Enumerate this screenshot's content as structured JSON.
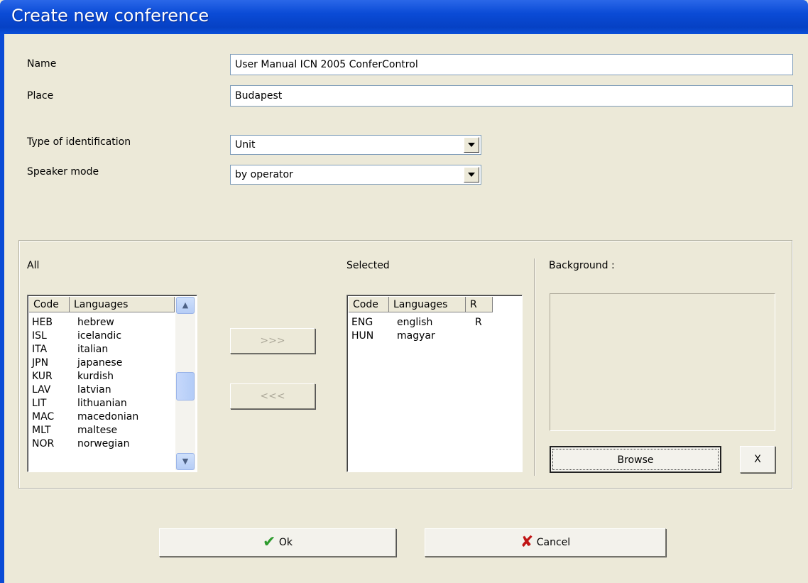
{
  "window": {
    "title": "Create new conference"
  },
  "form": {
    "name_label": "Name",
    "name_value": "User Manual ICN 2005 ConferControl",
    "place_label": "Place",
    "place_value": "Budapest",
    "identification_label": "Type of identification",
    "identification_value": "Unit",
    "speaker_mode_label": "Speaker mode",
    "speaker_mode_value": "by operator"
  },
  "all_list": {
    "title": "All",
    "col_code": "Code",
    "col_languages": "Languages",
    "rows": [
      {
        "code": "HEB",
        "language": "hebrew"
      },
      {
        "code": "ISL",
        "language": "icelandic"
      },
      {
        "code": "ITA",
        "language": "italian"
      },
      {
        "code": "JPN",
        "language": "japanese"
      },
      {
        "code": "KUR",
        "language": "kurdish"
      },
      {
        "code": "LAV",
        "language": "latvian"
      },
      {
        "code": "LIT",
        "language": "lithuanian"
      },
      {
        "code": "MAC",
        "language": "macedonian"
      },
      {
        "code": "MLT",
        "language": "maltese"
      },
      {
        "code": "NOR",
        "language": "norwegian"
      }
    ]
  },
  "transfer": {
    "add_label": ">>>",
    "remove_label": "<<<"
  },
  "selected_list": {
    "title": "Selected",
    "col_code": "Code",
    "col_languages": "Languages",
    "col_r": "R",
    "rows": [
      {
        "code": "ENG",
        "language": "english",
        "r": "R"
      },
      {
        "code": "HUN",
        "language": "magyar",
        "r": ""
      }
    ]
  },
  "background": {
    "label": "Background :",
    "browse_label": "Browse",
    "clear_label": "X"
  },
  "footer": {
    "ok_label": "Ok",
    "cancel_label": "Cancel"
  },
  "icons": {
    "ok": "check-icon",
    "cancel": "x-mark-icon"
  },
  "colors": {
    "titlebar": "#0a4bd6",
    "dialog_bg": "#ece9d8",
    "ok_icon": "#2d9b2d",
    "cancel_icon": "#c01515"
  }
}
